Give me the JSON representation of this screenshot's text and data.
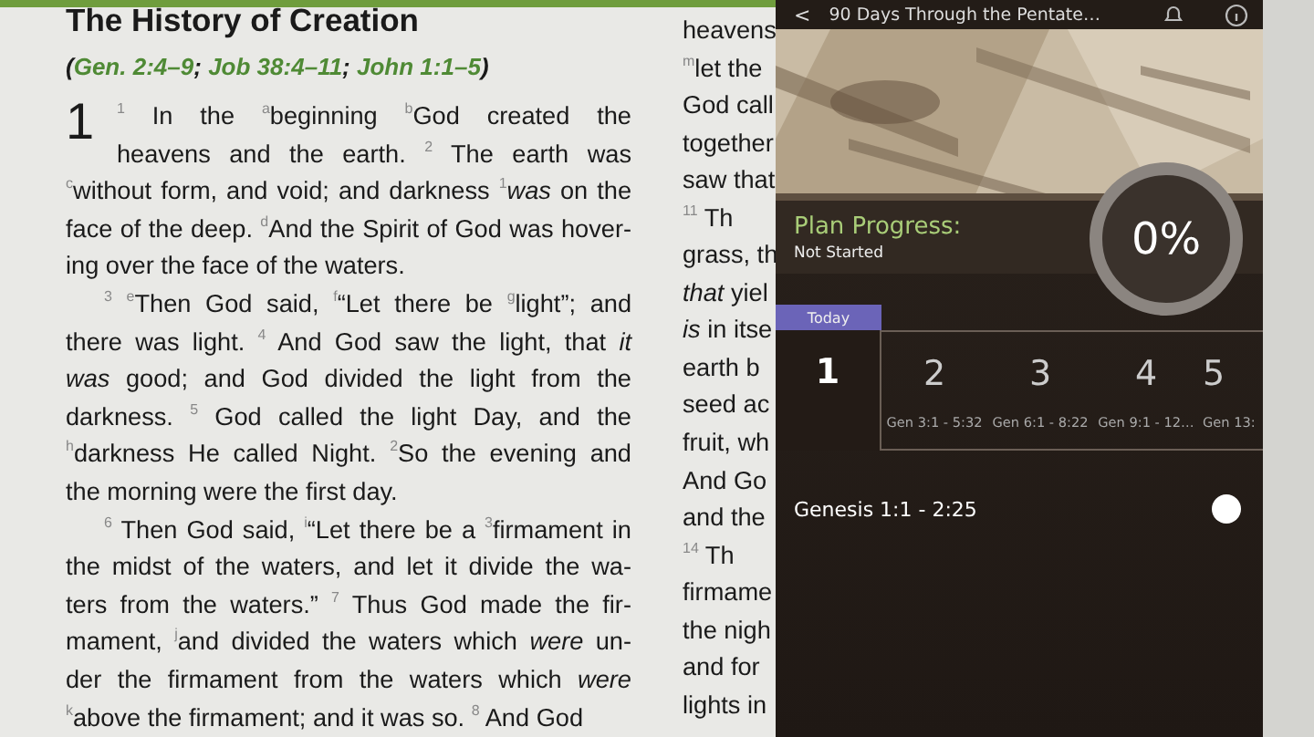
{
  "reader": {
    "title": "The History of Creation",
    "cross_references_open": "(",
    "cross_references": [
      {
        "text": "Gen. 2:4–9",
        "after": ";"
      },
      {
        "text": "Job 38:4–11",
        "after": ";"
      },
      {
        "text": "John 1:1–5",
        "after": ")"
      }
    ],
    "chapter": "1",
    "paragraphs": [
      {
        "kind": "chapter_start",
        "lines": [
          "$^{1}$ In the $^{a}$beginning $^{b}$God created the",
          "heavens and the earth. $^{2}$ The earth was",
          "$^{c}$without form, and void; and darkness $^{1}$*was* on the",
          "face of the deep. $^{d}$And the Spirit of God was hover-",
          "ing over the face of the waters."
        ]
      },
      {
        "kind": "indented",
        "lines": [
          "$^{3}$ $^{e}$Then God said, $^{f}$“Let there be $^{g}$light”; and",
          "there was light. $^{4}$ And God saw the light, that *it*",
          "*was* good; and God divided the light from the",
          "darkness. $^{5}$ God called the light Day, and the",
          "$^{h}$darkness He called Night. $^{2}$So the evening and",
          "the morning were the first day."
        ]
      },
      {
        "kind": "indented",
        "lines": [
          "$^{6}$ Then God said, $^{i}$“Let there be a $^{3}$firmament in",
          "the midst of the waters, and let it divide the wa-",
          "ters from the waters.” $^{7}$ Thus God made the fir-",
          "mament, $^{j}$and divided the waters which *were* un-",
          "der the firmament from the waters which *were*",
          "$^{k}$above the firmament; and it was so. $^{8}$ And God"
        ]
      }
    ]
  },
  "next_column": [
    "heavens",
    "$^{m}$let the",
    "God call",
    "together",
    "saw that",
    "$^{11}$ Th",
    "grass, th",
    "*that* yiel",
    "*is* in itse",
    "earth b",
    "seed ac",
    "fruit, wh",
    "And Go",
    "and the",
    "$^{14}$ Th",
    "firmame",
    "the nigh",
    "and for",
    "lights in"
  ],
  "plan": {
    "back": "<",
    "title": "90 Days Through the Pentate…",
    "progress_label": "Plan Progress:",
    "progress_status": "Not Started",
    "percent": "0%",
    "today": "Today",
    "days": [
      {
        "number": "1",
        "selected": true
      },
      {
        "number": "2",
        "reference": "Gen 3:1 - 5:32",
        "selected": false
      },
      {
        "number": "3",
        "reference": "Gen 6:1 - 8:22",
        "selected": false
      },
      {
        "number": "4",
        "reference": "Gen 9:1 - 12…",
        "selected": false
      },
      {
        "number": "5",
        "reference": "Gen 13:",
        "selected": false
      }
    ],
    "readings": [
      {
        "reference": "Genesis 1:1 - 2:25",
        "completed": false
      }
    ]
  }
}
